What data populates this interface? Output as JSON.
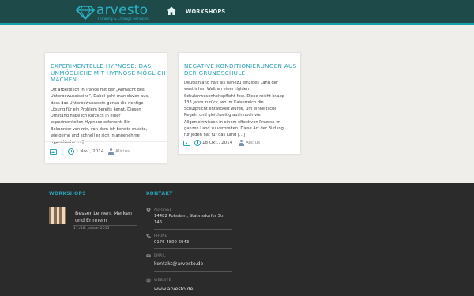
{
  "header": {
    "logo_text": "arvesto",
    "logo_tagline": "Thinking & Change Services",
    "nav_home_icon": "home-icon",
    "nav_workshops": "WORKSHOPS",
    "accent": "#16a0aa"
  },
  "posts": [
    {
      "title": "EXPERIMENTELLE HYPNOSE: DAS UNMÖGLICHE MIT HYPNOSE MÖGLICH MACHEN",
      "lines": [
        "Oft arbeite ich in Trance mit der „Allmacht des",
        "Unterbewusstseins“. Dabei geht man davon aus,",
        "dass das Unterbewusstsein genau die richtige",
        "Lösung für ein Problem bereits kennt. Diesen",
        "Umstand habe ich kürzlich in einer",
        "experimentellen Hypnose erforscht. Ein",
        "Bekannter von mir, von dem ich bereits wusste,",
        "wie gerne und schnell er sich in angenehme",
        "hypnotische […]"
      ],
      "date": "1 Nov., 2014",
      "author": "Alicius"
    },
    {
      "title": "NEGATIVE KONDITIONIERUNGEN AUS DER GRUNDSCHULE",
      "lines": [
        "Deutschland hält als nahezu einziges Land der",
        "westlichen Welt an einer rigiden",
        "Schulanwesenheitspflicht fest. Diese reicht knapp",
        "133 Jahre zurück, wo im Kaiserreich die",
        "Schulpflicht entwickelt wurde, um einheitliche",
        "Regeln und gleichzeitig auch noch viel",
        "Allgemeinwissen in einem effektiven Prozess im",
        "ganzen Land zu verbreiten. Diese Art der Bildung",
        "für jeden hat für das Land […]"
      ],
      "date": "18 Okt., 2014",
      "author": "Alicius"
    }
  ],
  "footer": {
    "workshops_title": "WORKSHOPS",
    "workshop": {
      "title": "Besser Lernen, Merken und Erinnern",
      "date": "17./18. Januar 2015"
    },
    "kontakt_title": "KONTAKT",
    "kontakt": [
      {
        "icon": "map-pin-icon",
        "label": "ADRESSE",
        "lines": [
          "14482 Potsdam, Stahnsdorfer Str.",
          "146"
        ]
      },
      {
        "icon": "phone-icon",
        "label": "PHONE",
        "lines": [
          "0176-4800-6943"
        ]
      },
      {
        "icon": "envelope-icon",
        "label": "EMAIL",
        "lines": [
          "kontakt@arvesto.de"
        ]
      },
      {
        "icon": "globe-icon",
        "label": "WEBSITE",
        "lines": [
          "www.arvesto.de"
        ]
      }
    ]
  }
}
